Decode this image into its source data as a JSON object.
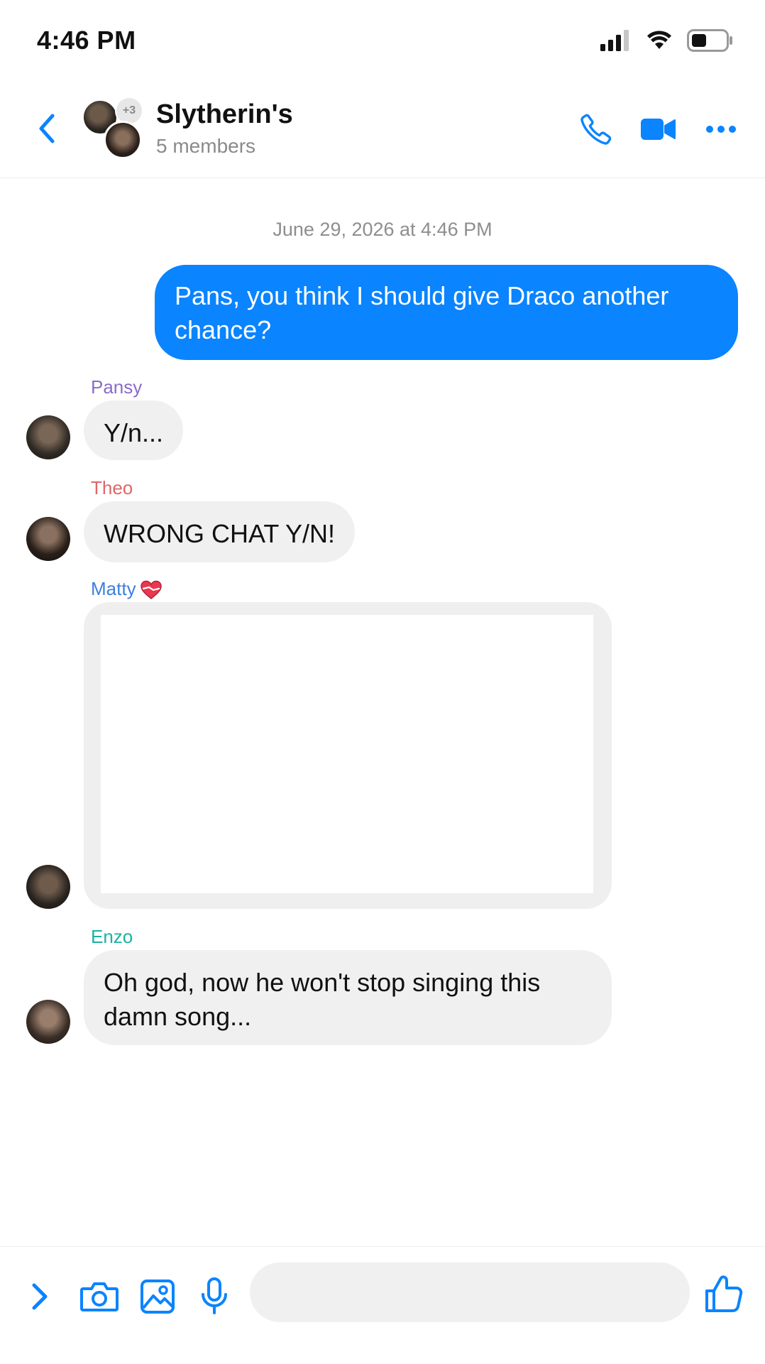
{
  "status_bar": {
    "time": "4:46 PM",
    "icons": [
      "signal-icon",
      "wifi-icon",
      "battery-icon"
    ]
  },
  "header": {
    "title": "Slytherin's",
    "subtitle": "5 members",
    "avatar_extra_count": "+3",
    "icons": [
      "back-icon",
      "phone-icon",
      "video-icon",
      "more-icon"
    ]
  },
  "chat": {
    "timestamp": "June 29, 2026 at 4:46 PM",
    "outgoing": [
      {
        "text": "Pans, you think I should give Draco another chance?"
      }
    ],
    "incoming": [
      {
        "sender": "Pansy",
        "text": "Y/n...",
        "color": "#8a6cc8"
      },
      {
        "sender": "Theo",
        "text": "WRONG CHAT Y/N!",
        "color": "#e06666"
      },
      {
        "sender": "Matty",
        "text": "",
        "color": "#3d7fe0",
        "attachment": "media"
      },
      {
        "sender": "Enzo",
        "text": "Oh god, now he won't stop singing this damn song...",
        "color": "#19b3a0"
      }
    ]
  },
  "composer": {
    "placeholder": "",
    "icons": [
      "expand-icon",
      "camera-icon",
      "gallery-icon",
      "microphone-icon",
      "like-icon"
    ]
  },
  "colors": {
    "accent": "#0a84ff",
    "incoming_bubble": "#f0f0f0",
    "outgoing_bubble": "#0a84ff"
  }
}
